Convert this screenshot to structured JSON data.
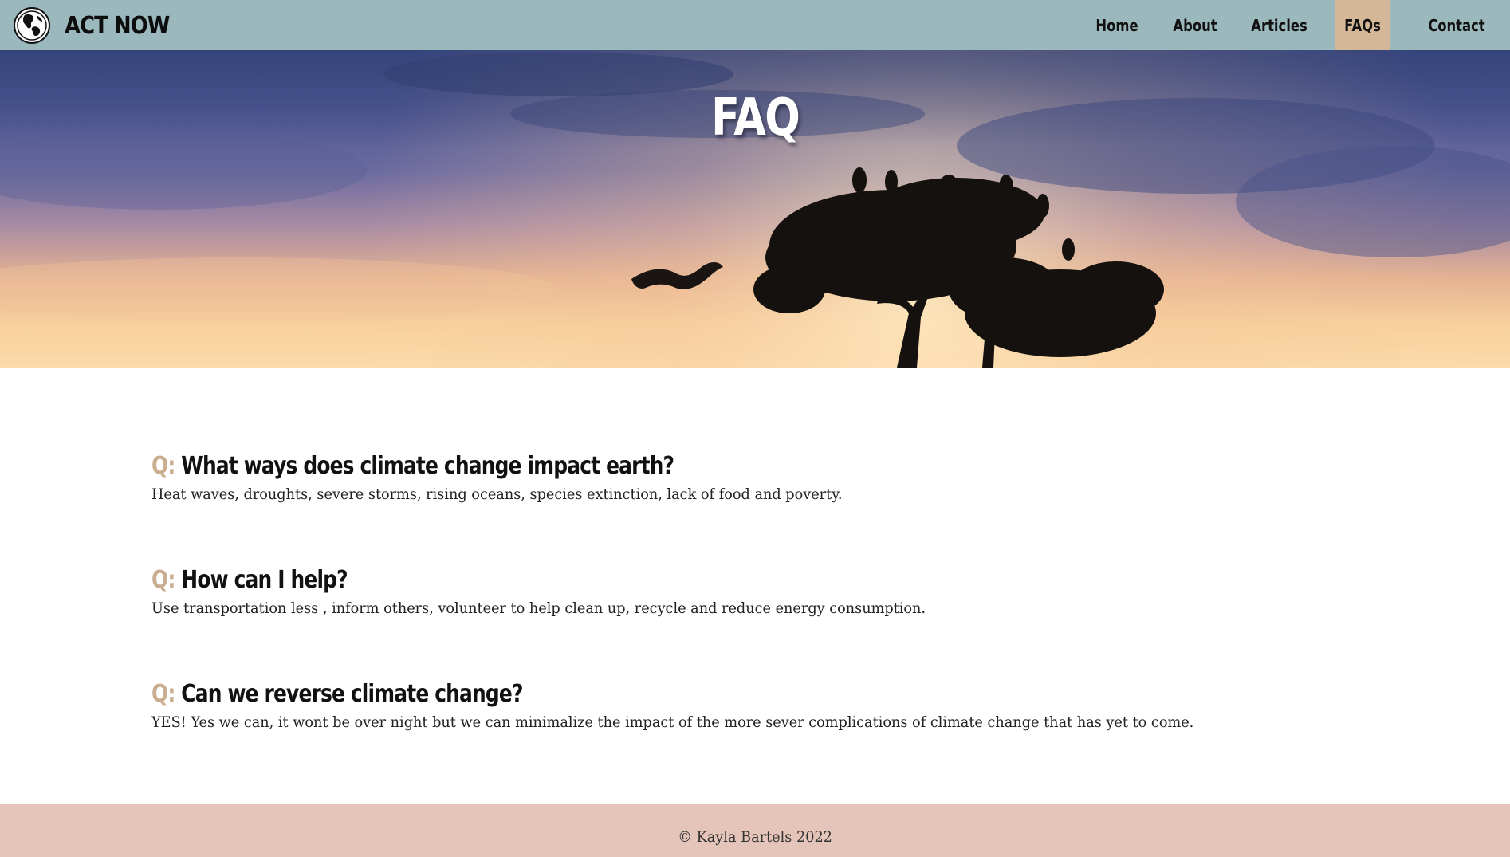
{
  "brand": {
    "name": "ACT NOW",
    "logo_icon": "globe-icon"
  },
  "nav": {
    "items": [
      {
        "label": "Home",
        "active": false
      },
      {
        "label": "About",
        "active": false
      },
      {
        "label": "Articles",
        "active": false
      },
      {
        "label": "FAQs",
        "active": true
      },
      {
        "label": "Contact",
        "active": false
      }
    ]
  },
  "hero": {
    "title": "FAQ"
  },
  "faq": {
    "prefix": "Q:",
    "items": [
      {
        "question": "What ways does climate change impact earth?",
        "answer": "Heat waves, droughts, severe storms, rising oceans, species extinction, lack of food and poverty."
      },
      {
        "question": "How can I help?",
        "answer": "Use transportation less , inform others, volunteer to help clean up, recycle and reduce energy consumption."
      },
      {
        "question": "Can we reverse climate change?",
        "answer": "YES! Yes we can, it wont be over night but we can minimalize the impact of the more sever complications of climate change that has yet to come."
      }
    ]
  },
  "footer": {
    "text": "© Kayla Bartels 2022"
  },
  "colors": {
    "navbar_bg": "#9bb8bd",
    "nav_active_bg": "#d3b796",
    "question_prefix": "#c9ad8f",
    "footer_bg": "#e5c5ba"
  }
}
